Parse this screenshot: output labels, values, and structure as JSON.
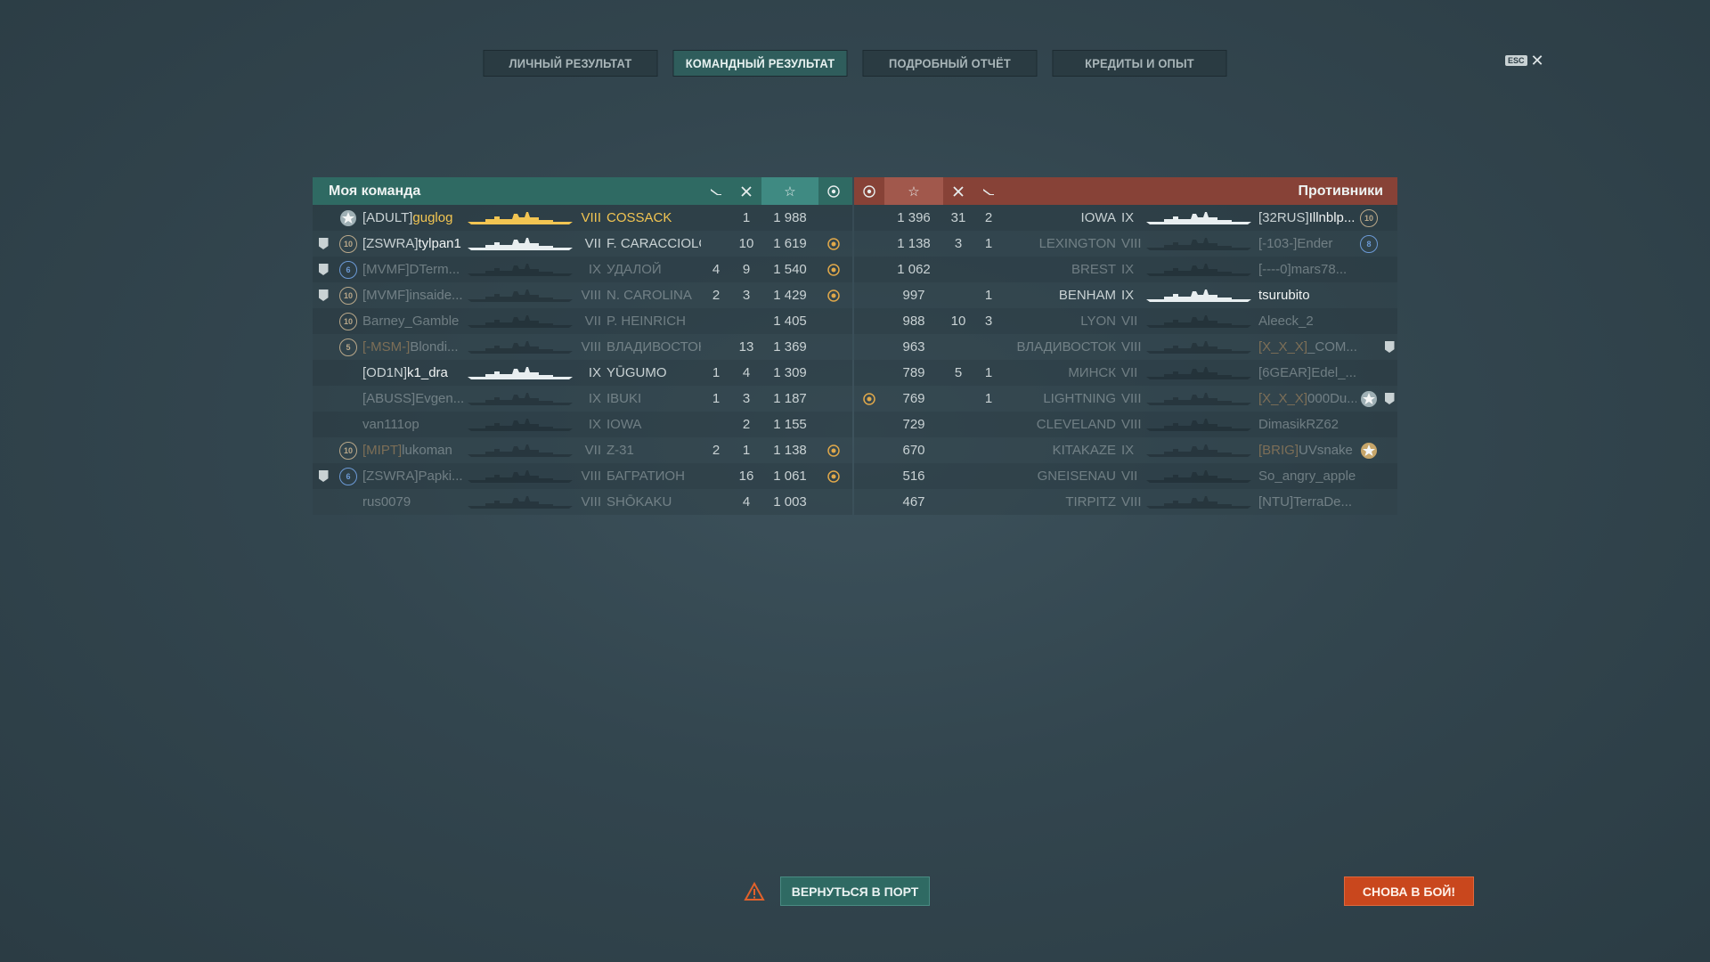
{
  "tabs": [
    {
      "label": "ЛИЧНЫЙ РЕЗУЛЬТАТ",
      "active": false
    },
    {
      "label": "КОМАНДНЫЙ РЕЗУЛЬТАТ",
      "active": true
    },
    {
      "label": "ПОДРОБНЫЙ ОТЧЁТ",
      "active": false
    },
    {
      "label": "КРЕДИТЫ И ОПЫТ",
      "active": false
    }
  ],
  "close": {
    "esc_label": "ESC",
    "icon": "close-icon"
  },
  "my_team": {
    "title": "Моя команда",
    "header_icons": [
      "plane-kills-icon",
      "ship-kills-icon",
      "star-icon",
      "achievement-icon"
    ],
    "accent": "#2f6a63",
    "rows": [
      {
        "clan": "[ADULT]",
        "player": "guglog",
        "tier": "VIII",
        "ship": "COSSACK",
        "planes": "",
        "kills": "1",
        "xp": "1 988",
        "achievement": false,
        "division": false,
        "rank": "star",
        "style": "gold"
      },
      {
        "clan": "[ZSWRA]",
        "player": "tylpan1",
        "tier": "VII",
        "ship": "F. CARACCIOLO",
        "planes": "",
        "kills": "10",
        "xp": "1 619",
        "achievement": true,
        "division": true,
        "rank": "10",
        "style": "white"
      },
      {
        "clan": "[MVMF]",
        "player": "DTerm...",
        "tier": "IX",
        "ship": "УДАЛОЙ",
        "planes": "4",
        "kills": "9",
        "xp": "1 540",
        "achievement": true,
        "division": true,
        "rank": "6",
        "style": "dim"
      },
      {
        "clan": "[MVMF]",
        "player": "insaide...",
        "tier": "VIII",
        "ship": "N. CAROLINA",
        "planes": "2",
        "kills": "3",
        "xp": "1 429",
        "achievement": true,
        "division": true,
        "rank": "10",
        "style": "dim"
      },
      {
        "clan": "",
        "player": "Barney_Gamble",
        "tier": "VII",
        "ship": "P. HEINRICH",
        "planes": "",
        "kills": "",
        "xp": "1 405",
        "achievement": false,
        "division": false,
        "rank": "10",
        "style": "dim"
      },
      {
        "clan": "[-MSM-]",
        "player": "Blondi...",
        "tier": "VIII",
        "ship": "ВЛАДИВОСТОК",
        "planes": "",
        "kills": "13",
        "xp": "1 369",
        "achievement": false,
        "division": false,
        "rank": "5",
        "style": "dim-orange"
      },
      {
        "clan": "[OD1N]",
        "player": "k1_dra",
        "tier": "IX",
        "ship": "YŪGUMO",
        "planes": "1",
        "kills": "4",
        "xp": "1 309",
        "achievement": false,
        "division": false,
        "rank": "",
        "style": "white"
      },
      {
        "clan": "[ABUSS]",
        "player": "Evgen...",
        "tier": "IX",
        "ship": "IBUKI",
        "planes": "1",
        "kills": "3",
        "xp": "1 187",
        "achievement": false,
        "division": false,
        "rank": "",
        "style": "dim"
      },
      {
        "clan": "",
        "player": "van111op",
        "tier": "IX",
        "ship": "IOWA",
        "planes": "",
        "kills": "2",
        "xp": "1 155",
        "achievement": false,
        "division": false,
        "rank": "",
        "style": "dim"
      },
      {
        "clan": "[MIPT]",
        "player": "lukoman",
        "tier": "VII",
        "ship": "Z-31",
        "planes": "2",
        "kills": "1",
        "xp": "1 138",
        "achievement": true,
        "division": false,
        "rank": "10",
        "style": "dim-orange"
      },
      {
        "clan": "[ZSWRA]",
        "player": "Papki...",
        "tier": "VIII",
        "ship": "БАГРАТИОН",
        "planes": "",
        "kills": "16",
        "xp": "1 061",
        "achievement": true,
        "division": true,
        "rank": "6",
        "style": "dim"
      },
      {
        "clan": "",
        "player": "rus0079",
        "tier": "VIII",
        "ship": "SHŌKAKU",
        "planes": "",
        "kills": "4",
        "xp": "1 003",
        "achievement": false,
        "division": false,
        "rank": "",
        "style": "dim"
      }
    ]
  },
  "enemy_team": {
    "title": "Противники",
    "header_icons": [
      "achievement-icon",
      "star-icon",
      "ship-kills-icon",
      "plane-kills-icon"
    ],
    "accent": "#874237",
    "rows": [
      {
        "clan": "[32RUS]",
        "player": "Illnblp...",
        "tier": "IX",
        "ship": "IOWA",
        "planes": "2",
        "kills": "31",
        "xp": "1 396",
        "achievement": false,
        "division": false,
        "rank": "10",
        "style": "white"
      },
      {
        "clan": "[-103-]",
        "player": "Ender",
        "tier": "VIII",
        "ship": "LEXINGTON",
        "planes": "1",
        "kills": "3",
        "xp": "1 138",
        "achievement": false,
        "division": false,
        "rank": "8",
        "style": "dim"
      },
      {
        "clan": "[----0]",
        "player": "mars78...",
        "tier": "IX",
        "ship": "BREST",
        "planes": "",
        "kills": "",
        "xp": "1 062",
        "achievement": false,
        "division": false,
        "rank": "",
        "style": "dim"
      },
      {
        "clan": "",
        "player": "tsurubito",
        "tier": "IX",
        "ship": "BENHAM",
        "planes": "1",
        "kills": "",
        "xp": "997",
        "achievement": false,
        "division": false,
        "rank": "",
        "style": "white"
      },
      {
        "clan": "",
        "player": "Aleeck_2",
        "tier": "VII",
        "ship": "LYON",
        "planes": "3",
        "kills": "10",
        "xp": "988",
        "achievement": false,
        "division": false,
        "rank": "",
        "style": "dim"
      },
      {
        "clan": "[X_X_X]",
        "player": "_COM...",
        "tier": "VIII",
        "ship": "ВЛАДИВОСТОК",
        "planes": "",
        "kills": "",
        "xp": "963",
        "achievement": false,
        "division": true,
        "rank": "",
        "style": "dim-orange"
      },
      {
        "clan": "[6GEAR]",
        "player": "Edel_...",
        "tier": "VII",
        "ship": "МИНСК",
        "planes": "1",
        "kills": "5",
        "xp": "789",
        "achievement": false,
        "division": false,
        "rank": "",
        "style": "dim"
      },
      {
        "clan": "[X_X_X]",
        "player": "000Du...",
        "tier": "VIII",
        "ship": "LIGHTNING",
        "planes": "1",
        "kills": "",
        "xp": "769",
        "achievement": true,
        "division": true,
        "rank": "star",
        "style": "dim-orange"
      },
      {
        "clan": "",
        "player": "DimasikRZ62",
        "tier": "VIII",
        "ship": "CLEVELAND",
        "planes": "",
        "kills": "",
        "xp": "729",
        "achievement": false,
        "division": false,
        "rank": "",
        "style": "dim"
      },
      {
        "clan": "[BRIG]",
        "player": "UVsnake",
        "tier": "IX",
        "ship": "KITAKAZE",
        "planes": "",
        "kills": "",
        "xp": "670",
        "achievement": false,
        "division": false,
        "rank": "star",
        "style": "dim-tan"
      },
      {
        "clan": "",
        "player": "So_angry_apple",
        "tier": "VII",
        "ship": "GNEISENAU",
        "planes": "",
        "kills": "",
        "xp": "516",
        "achievement": false,
        "division": false,
        "rank": "",
        "style": "dim"
      },
      {
        "clan": "[NTU]",
        "player": "TerraDe...",
        "tier": "VIII",
        "ship": "TIRPITZ",
        "planes": "",
        "kills": "",
        "xp": "467",
        "achievement": false,
        "division": false,
        "rank": "",
        "style": "dim"
      }
    ]
  },
  "bottom": {
    "warning_icon": "warning-icon",
    "return_label": "ВЕРНУТЬСЯ В ПОРТ",
    "battle_label": "СНОВА В БОЙ!",
    "battle_color": "#c9471d"
  }
}
